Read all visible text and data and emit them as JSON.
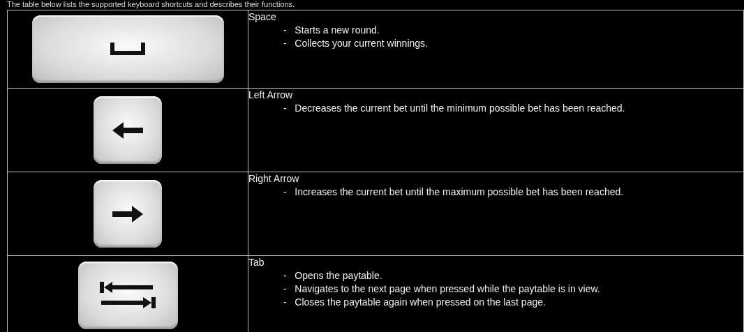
{
  "intro": "The table below lists the supported keyboard shortcuts and describes their functions.",
  "shortcuts": [
    {
      "kind": "space",
      "name": "Space",
      "descriptions": [
        "-   Starts a new round.",
        "-   Collects your current winnings."
      ]
    },
    {
      "kind": "left",
      "name": "Left Arrow",
      "descriptions": [
        "-   Decreases the current bet until the minimum possible bet has been reached."
      ]
    },
    {
      "kind": "right",
      "name": "Right Arrow",
      "descriptions": [
        "-   Increases the current bet until the maximum possible bet has been reached."
      ]
    },
    {
      "kind": "tab",
      "name": "Tab",
      "descriptions": [
        "-   Opens the paytable.",
        "-   Navigates to the next page when pressed while the paytable is in view.",
        "-   Closes the paytable again when pressed on the last page."
      ]
    }
  ]
}
